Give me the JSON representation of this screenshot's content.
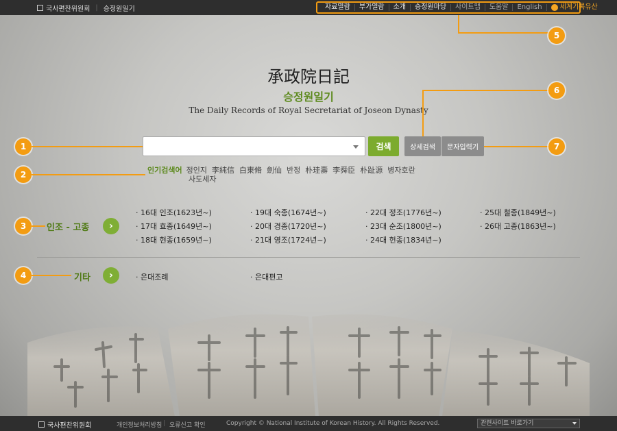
{
  "header": {
    "brand": "국사편찬위원회",
    "site": "승정원일기",
    "nav": [
      "자료열람",
      "부가열람",
      "소개",
      "승정원마당",
      "사이트맵",
      "도움말",
      "English"
    ],
    "world_heritage": "세계기록유산"
  },
  "title": {
    "hanja": "承政院日記",
    "korean": "승정원일기",
    "english": "The Daily Records of Royal Secretariat of Joseon Dynasty"
  },
  "search": {
    "placeholder": "",
    "button": "검색",
    "detail_button": "상세검색",
    "char_input_button": "문자입력기"
  },
  "popular": {
    "label": "인기검색어",
    "keywords": [
      "정인지",
      "李純信",
      "白東脩",
      "劍仙",
      "반정",
      "朴珪壽",
      "李舜臣",
      "朴趾源",
      "병자호란",
      "사도세자"
    ]
  },
  "kings_section": {
    "label": "인조 - 고종",
    "columns": [
      [
        "· 16대 인조(1623년~)",
        "· 17대 효종(1649년~)",
        "· 18대 현종(1659년~)"
      ],
      [
        "· 19대 숙종(1674년~)",
        "· 20대 경종(1720년~)",
        "· 21대 영조(1724년~)"
      ],
      [
        "· 22대 정조(1776년~)",
        "· 23대 순조(1800년~)",
        "· 24대 헌종(1834년~)"
      ],
      [
        "· 25대 철종(1849년~)",
        "· 26대 고종(1863년~)"
      ]
    ]
  },
  "etc_section": {
    "label": "기타",
    "items": [
      "· 은대조례",
      "· 은대편고"
    ]
  },
  "callouts": [
    "1",
    "2",
    "3",
    "4",
    "5",
    "6",
    "7"
  ],
  "footer": {
    "brand": "국사편찬위원회",
    "privacy": "개인정보처리방침",
    "error_report": "오류신고 확인",
    "copyright": "Copyright © National Institute of Korean History. All Rights Reserved.",
    "related_sites": "관련사이트 바로가기"
  },
  "colors": {
    "accent": "#f39c12",
    "green": "#7cab2e",
    "topbar": "#2e2e2e"
  }
}
